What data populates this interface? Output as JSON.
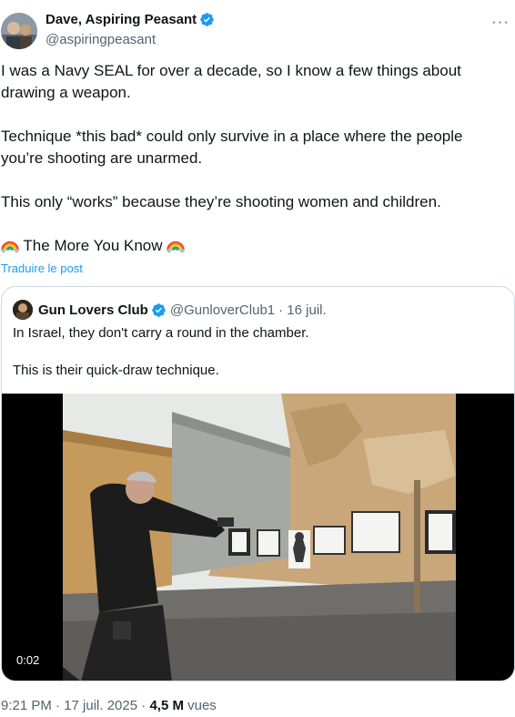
{
  "author": {
    "display_name": "Dave, Aspiring Peasant",
    "handle": "@aspiringpeasant"
  },
  "tweet": {
    "paragraphs": [
      "I was a Navy SEAL for over a decade, so I know a few things about drawing a weapon.",
      "Technique *this bad* could only survive in a place where the people you’re shooting are unarmed.",
      "This only “works” because they’re shooting women and children."
    ],
    "closing_line": "The More You Know",
    "closing_icon": "rainbow-icon",
    "translate_label": "Traduire le post"
  },
  "quoted": {
    "display_name": "Gun Lovers Club",
    "handle": "@GunloverClub1",
    "date": "· 16 juil.",
    "line1": "In Israel, they don't carry a round in the chamber.",
    "line2": "This is their quick-draw technique.",
    "video_duration": "0:02"
  },
  "meta": {
    "time_date": "9:21 PM · 17 juil. 2025 ·",
    "views_count": "4,5 M",
    "views_label": "vues"
  },
  "colors": {
    "verified": "#1d9bf0",
    "link": "#1d9bf0",
    "muted": "#536471"
  }
}
